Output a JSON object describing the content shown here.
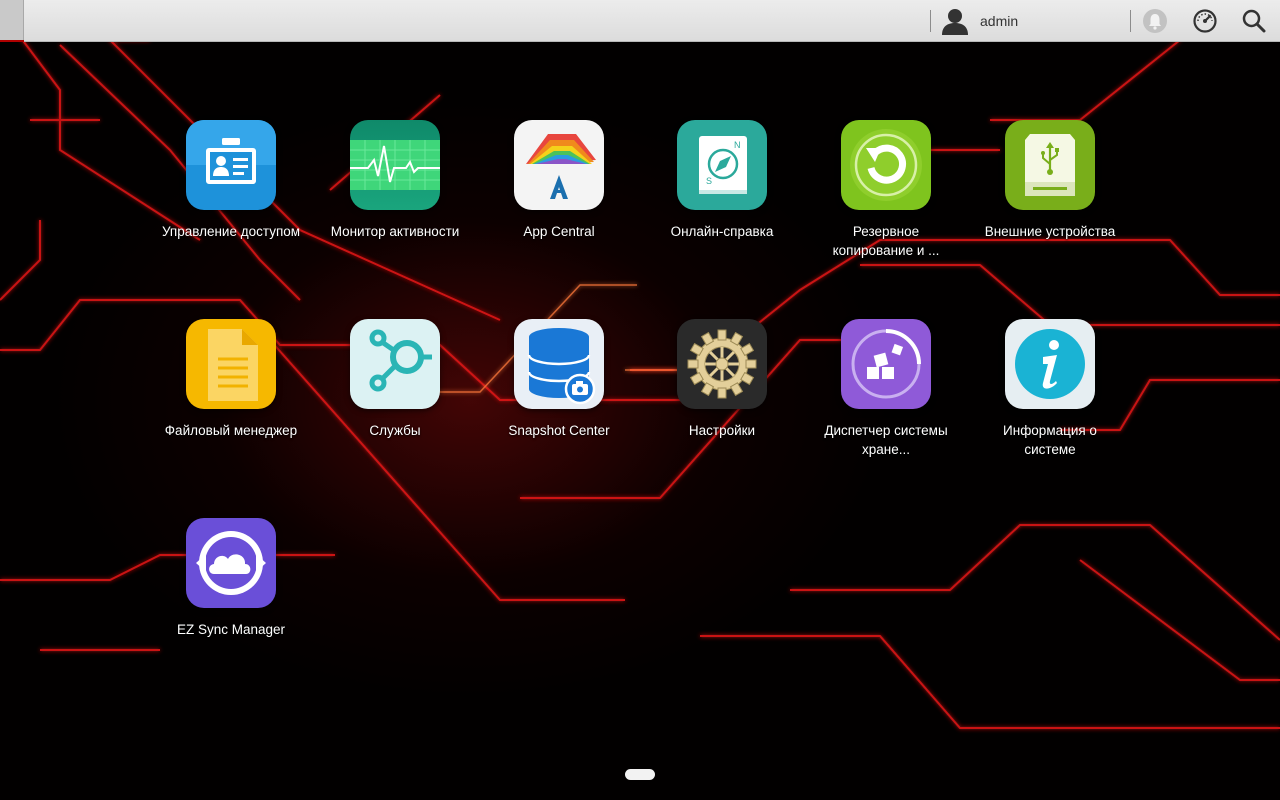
{
  "topbar": {
    "user_name": "admin",
    "user_icon": "user-icon",
    "notification_icon": "bell-icon",
    "monitor_icon": "speedometer-icon",
    "search_icon": "search-icon"
  },
  "apps": [
    {
      "label": "Управление доступом",
      "icon": "id-card-icon",
      "color": "#1f8fd6"
    },
    {
      "label": "Монитор активности",
      "icon": "heartbeat-monitor-icon",
      "color": "#18a878"
    },
    {
      "label": "App Central",
      "icon": "app-central-icon",
      "color": "#f2f2f2"
    },
    {
      "label": "Онлайн-справка",
      "icon": "compass-book-icon",
      "color": "#2aa89a"
    },
    {
      "label": "Резервное копирование и ...",
      "icon": "backup-refresh-icon",
      "color": "#7fc21e"
    },
    {
      "label": "Внешние устройства",
      "icon": "usb-drive-icon",
      "color": "#78ad1a"
    },
    {
      "label": "Файловый менеджер",
      "icon": "document-icon",
      "color": "#f5b400"
    },
    {
      "label": "Службы",
      "icon": "services-nodes-icon",
      "color": "#d9f0f2"
    },
    {
      "label": "Snapshot Center",
      "icon": "database-camera-icon",
      "color": "#e8eef5"
    },
    {
      "label": "Настройки",
      "icon": "gear-icon",
      "color": "#2b2b2b"
    },
    {
      "label": "Диспетчер системы хране...",
      "icon": "storage-cubes-icon",
      "color": "#8f5ad8"
    },
    {
      "label": "Информация о системе",
      "icon": "info-icon",
      "color": "#1ab3d4"
    },
    {
      "label": "EZ Sync Manager",
      "icon": "cloud-sync-icon",
      "color": "#6a4fd6"
    }
  ],
  "pagination": {
    "current_page": 1,
    "pages": 1
  }
}
